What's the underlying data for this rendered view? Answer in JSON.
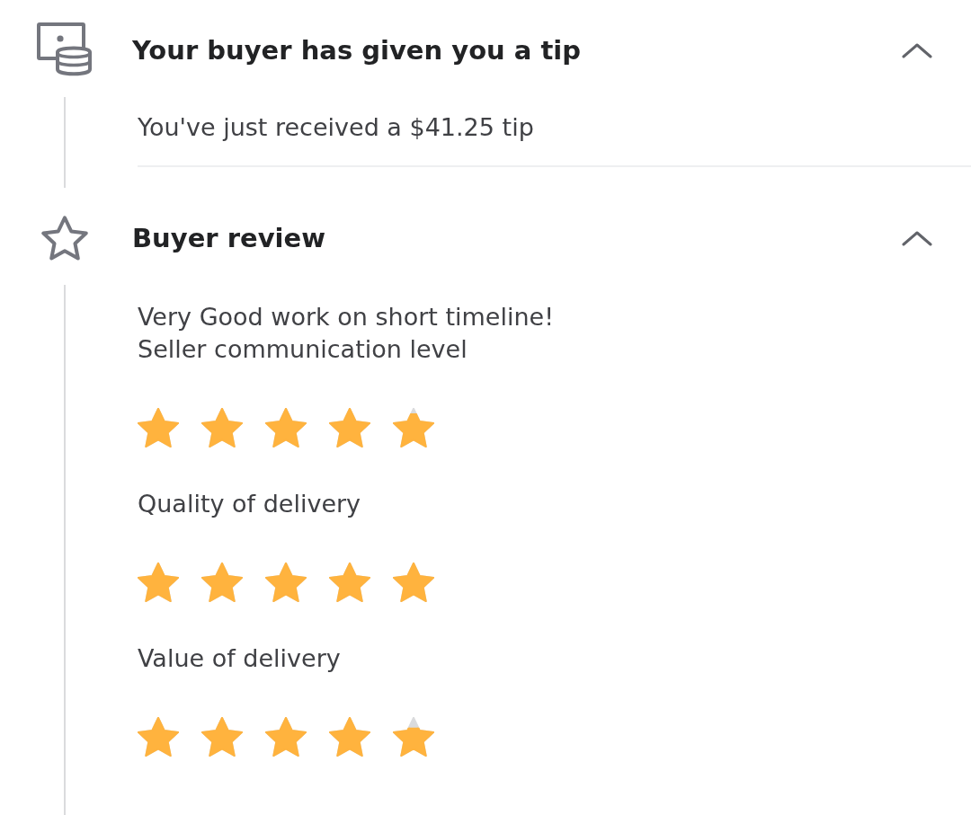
{
  "sections": [
    {
      "kind": "tip",
      "title": "Your buyer has given you a tip",
      "expanded": true,
      "message": "You've just received a $41.25 tip"
    },
    {
      "kind": "review",
      "title": "Buyer review",
      "expanded": true,
      "comment": "Very Good work on short timeline!",
      "ratings": [
        {
          "label": "Seller communication level",
          "stars": 4.8
        },
        {
          "label": "Quality of delivery",
          "stars": 5
        },
        {
          "label": "Value of delivery",
          "stars": 4.7
        }
      ]
    }
  ]
}
